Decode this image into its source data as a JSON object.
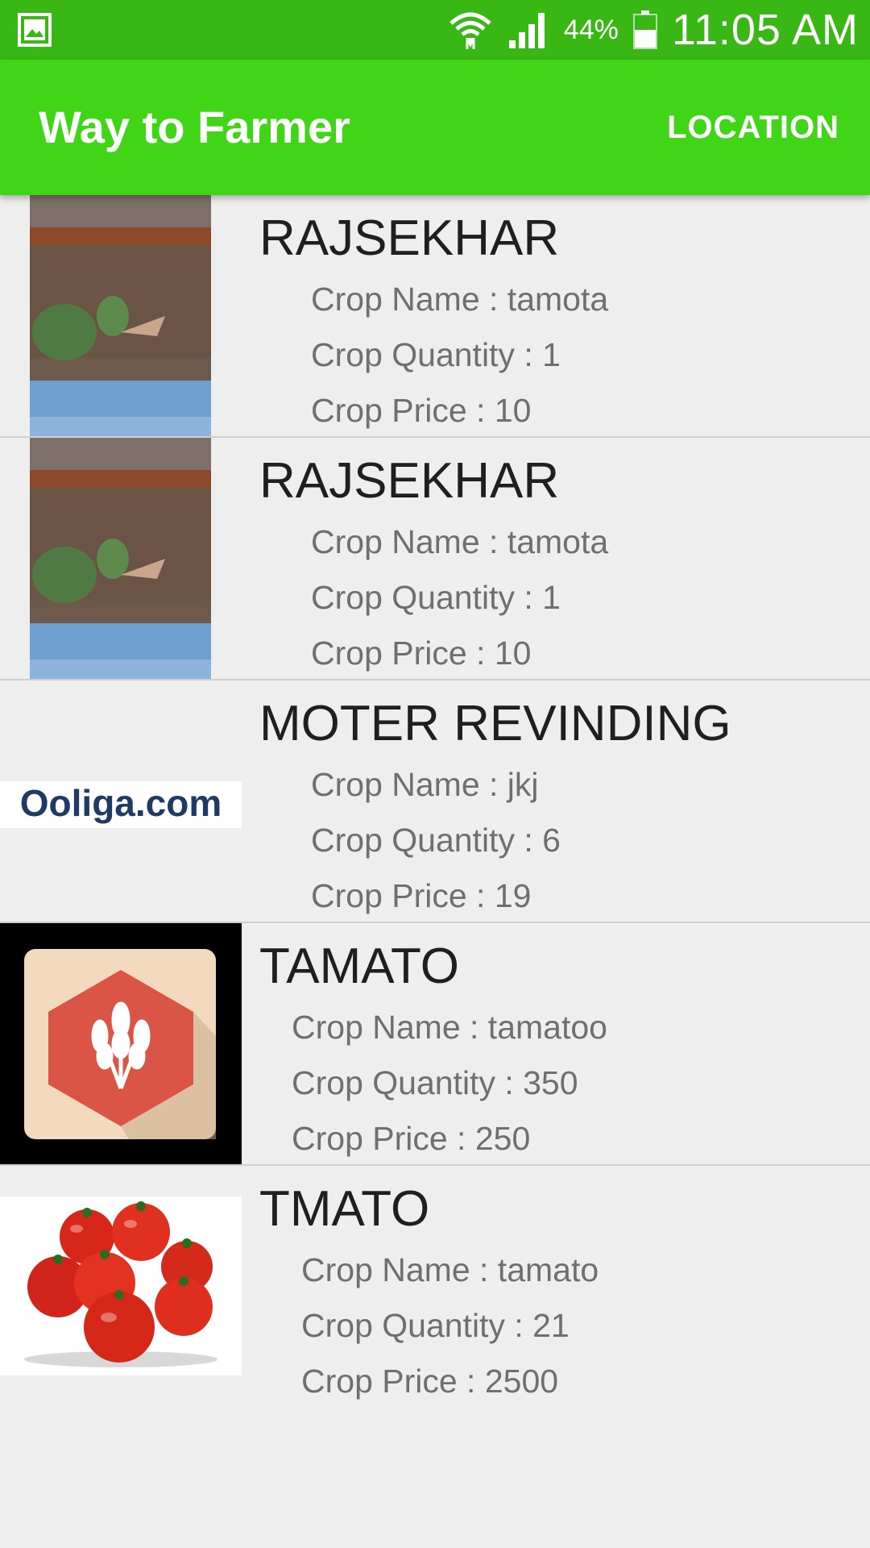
{
  "status_bar": {
    "battery_percent": "44%",
    "time": "11:05 AM"
  },
  "app_bar": {
    "title": "Way to Farmer",
    "action_label": "LOCATION"
  },
  "items": [
    {
      "name": "RAJSEKHAR",
      "crop_name": "Crop Name : tamota",
      "crop_quantity": "Crop Quantity : 1",
      "crop_price": "Crop Price : 10"
    },
    {
      "name": "RAJSEKHAR",
      "crop_name": "Crop Name : tamota",
      "crop_quantity": "Crop Quantity : 1",
      "crop_price": "Crop Price : 10"
    },
    {
      "name": "MOTER REVINDING",
      "logo_text": "Ooliga.com",
      "crop_name": "Crop Name : jkj",
      "crop_quantity": "Crop Quantity : 6",
      "crop_price": "Crop Price : 19"
    },
    {
      "name": "TAMATO",
      "crop_name": "Crop Name : tamatoo",
      "crop_quantity": "Crop Quantity : 350",
      "crop_price": "Crop Price : 250"
    },
    {
      "name": "TMATO",
      "crop_name": "Crop Name : tamato",
      "crop_quantity": "Crop Quantity : 21",
      "crop_price": "Crop Price : 2500"
    }
  ],
  "colors": {
    "status_bar": "#38b715",
    "app_bar": "#41d517",
    "background": "#eeeeee"
  }
}
